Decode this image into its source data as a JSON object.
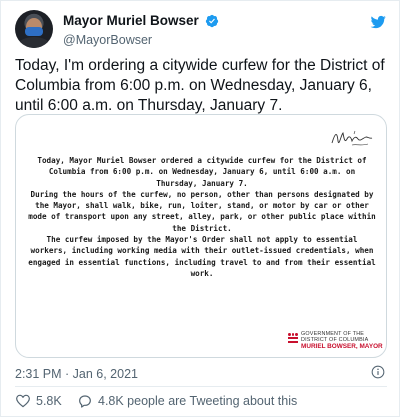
{
  "author": {
    "display_name": "Mayor Muriel Bowser",
    "handle": "@MayorBowser",
    "verified": true
  },
  "tweet": {
    "text": "Today, I'm ordering a citywide curfew for the District of Columbia from 6:00 p.m. on Wednesday, January 6, until 6:00 a.m. on Thursday, January 7.",
    "timestamp": "2:31 PM · Jan 6, 2021"
  },
  "image": {
    "paragraph1": "Today, Mayor Muriel Bowser ordered a citywide curfew for the District of Columbia from 6:00 p.m. on Wednesday, January 6, until 6:00 a.m. on Thursday, January 7.",
    "paragraph2": "During the hours of the curfew, no person, other than persons designated by the Mayor, shall walk, bike, run, loiter, stand, or motor by car or other mode of transport upon any street, alley, park, or other public place within the District.",
    "paragraph3": "The curfew imposed by the Mayor's Order shall not apply to essential workers, including working media with their outlet-issued credentials, when engaged in essential functions, including travel to and from their essential work.",
    "seal": {
      "line1": "GOVERNMENT OF THE",
      "line2": "DISTRICT OF COLUMBIA",
      "line3": "MURIEL BOWSER, MAYOR"
    }
  },
  "actions": {
    "likes": "5.8K",
    "tweeting_about": "4.8K people are Tweeting about this"
  },
  "colors": {
    "accent": "#1d9bf0",
    "text": "#0f1419",
    "muted": "#536471",
    "seal_red": "#c8102e"
  },
  "icons": {
    "verified": "verified-badge-icon",
    "brand": "twitter-bird-icon",
    "info": "info-icon",
    "like": "heart-icon",
    "reply": "speech-bubble-icon"
  }
}
